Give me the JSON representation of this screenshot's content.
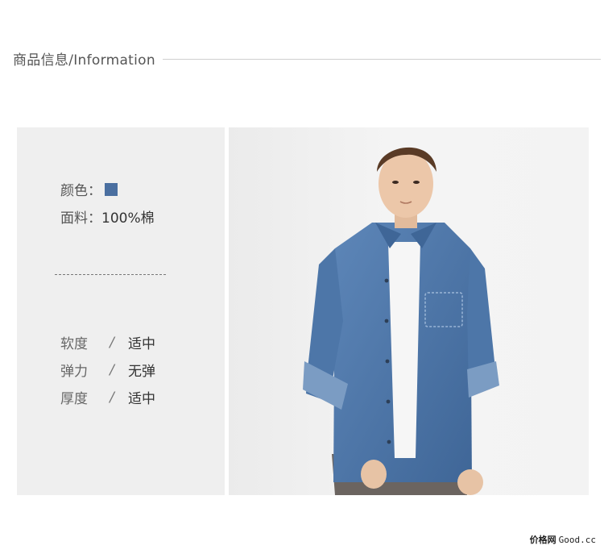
{
  "header": {
    "title": "商品信息/Information"
  },
  "info": {
    "color_label": "颜色：",
    "color_swatch": "#4a6fa0",
    "fabric_label": "面料：",
    "fabric_value": "100%棉",
    "attributes": [
      {
        "key": "软度",
        "sep": "/",
        "value": "适中"
      },
      {
        "key": "弹力",
        "sep": "/",
        "value": "无弹"
      },
      {
        "key": "厚度",
        "sep": "/",
        "value": "适中"
      }
    ]
  },
  "photo": {
    "subject": "model-wearing-denim-shirt"
  },
  "watermark": {
    "cn": "价格网",
    "en": "Good.cc"
  }
}
